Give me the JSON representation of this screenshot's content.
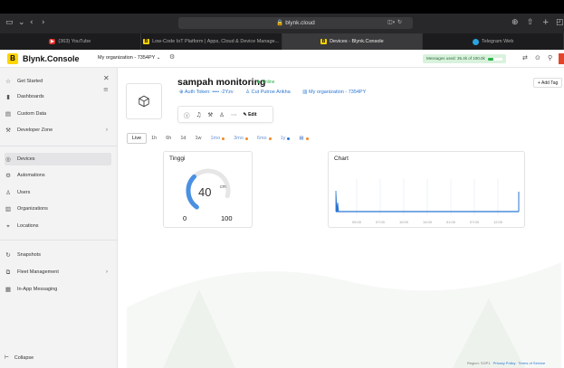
{
  "browser": {
    "url": "blynk.cloud",
    "tabs": [
      {
        "label": "(363) YouTube",
        "icon": "youtube-icon"
      },
      {
        "label": "Low-Code IoT Platform | Apps, Cloud & Device Manage...",
        "icon": "blynk-icon"
      },
      {
        "label": "Devices - Blynk.Console",
        "icon": "blynk-icon",
        "active": true
      },
      {
        "label": "Telegram Web",
        "icon": "telegram-icon"
      }
    ]
  },
  "header": {
    "brand": "Blynk.Console",
    "brand_mark": "B",
    "org": "My organization - 7354PY",
    "messages_used": "Messages used: 35.4k of 100.0k"
  },
  "sidebar": {
    "items": [
      {
        "label": "Get Started",
        "icon": "star-icon"
      },
      {
        "label": "Dashboards",
        "icon": "bar-chart-icon"
      },
      {
        "label": "Custom Data",
        "icon": "database-icon"
      },
      {
        "label": "Developer Zone",
        "icon": "developer-icon",
        "chevron": "›"
      },
      {
        "label": "Devices",
        "icon": "devices-icon",
        "active": true
      },
      {
        "label": "Automations",
        "icon": "automation-icon"
      },
      {
        "label": "Users",
        "icon": "users-icon"
      },
      {
        "label": "Organizations",
        "icon": "organization-icon"
      },
      {
        "label": "Locations",
        "icon": "location-icon"
      },
      {
        "label": "Snapshots",
        "icon": "snapshot-icon"
      },
      {
        "label": "Fleet Management",
        "icon": "fleet-icon",
        "chevron": "›"
      },
      {
        "label": "In-App Messaging",
        "icon": "message-icon"
      }
    ],
    "collapse": "Collapse"
  },
  "device": {
    "name": "sampah monitoring",
    "status": "Online",
    "auth_token": "Auth Token: •••• -2Yzv",
    "owner": "Cut Putroe Arikha",
    "org": "My organization - 7354PY",
    "add_tag": "Add Tag",
    "edit": "Edit"
  },
  "range_tabs": [
    {
      "label": "Live",
      "active": true
    },
    {
      "label": "1h"
    },
    {
      "label": "6h"
    },
    {
      "label": "1d"
    },
    {
      "label": "1w"
    },
    {
      "label": "1mo",
      "dot": "orange"
    },
    {
      "label": "3mo",
      "dot": "orange"
    },
    {
      "label": "6mo",
      "dot": "orange"
    },
    {
      "label": "1y",
      "dot": "blue"
    },
    {
      "label": "",
      "dot": "orange",
      "custom": true
    }
  ],
  "gauge": {
    "title": "Tinggi",
    "value": "40",
    "unit": "cm",
    "min": "0",
    "max": "100",
    "fraction": 0.4,
    "color": "#4a90e2"
  },
  "chart": {
    "title": "Chart",
    "x_ticks": [
      "05:00",
      "07:00",
      "10:00",
      "14:00",
      "01:00",
      "07:00",
      "12:00"
    ],
    "color": "#2a76d2"
  },
  "footer": {
    "region": "Region: SGP1",
    "privacy": "Privacy Policy",
    "terms": "Terms of Service"
  }
}
